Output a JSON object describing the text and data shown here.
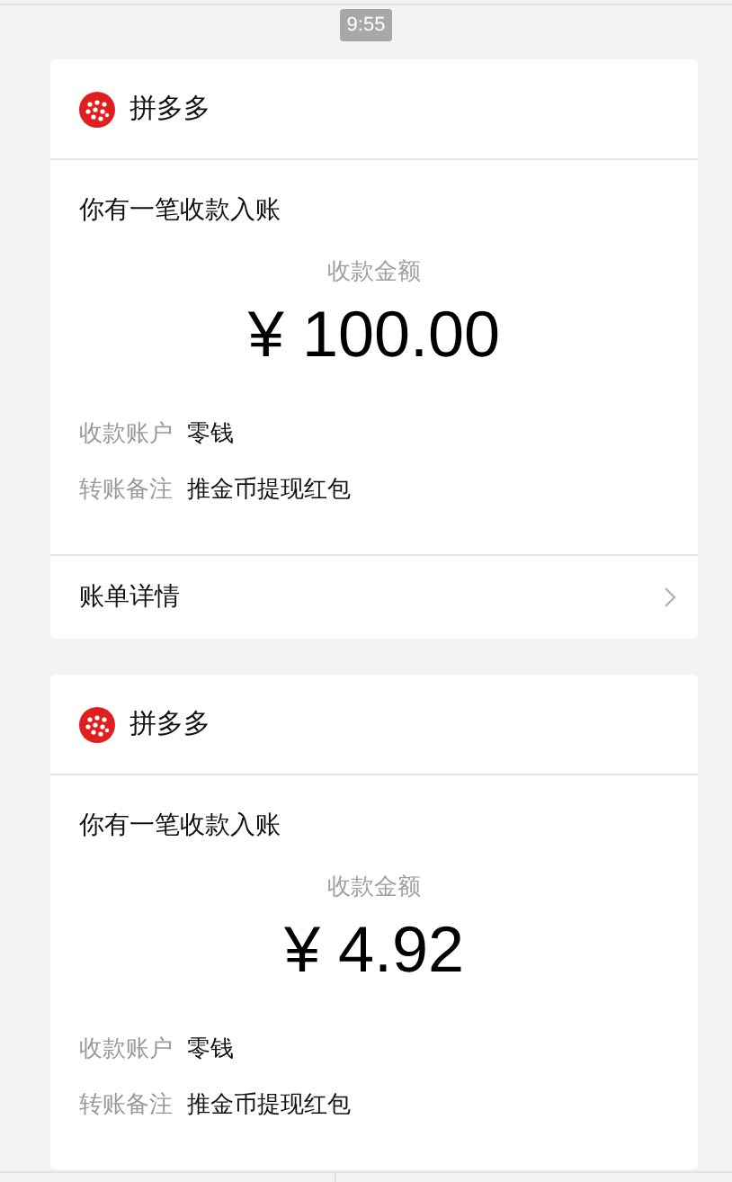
{
  "time": "9:55",
  "cards": [
    {
      "sender": "拼多多",
      "title": "你有一笔收款入账",
      "amount_label": "收款金额",
      "amount": "¥ 100.00",
      "rows": [
        {
          "label": "收款账户",
          "value": "零钱"
        },
        {
          "label": "转账备注",
          "value": "推金币提现红包"
        }
      ],
      "footer": "账单详情"
    },
    {
      "sender": "拼多多",
      "title": "你有一笔收款入账",
      "amount_label": "收款金额",
      "amount": "¥ 4.92",
      "rows": [
        {
          "label": "收款账户",
          "value": "零钱"
        },
        {
          "label": "转账备注",
          "value": "推金币提现红包"
        }
      ]
    }
  ]
}
